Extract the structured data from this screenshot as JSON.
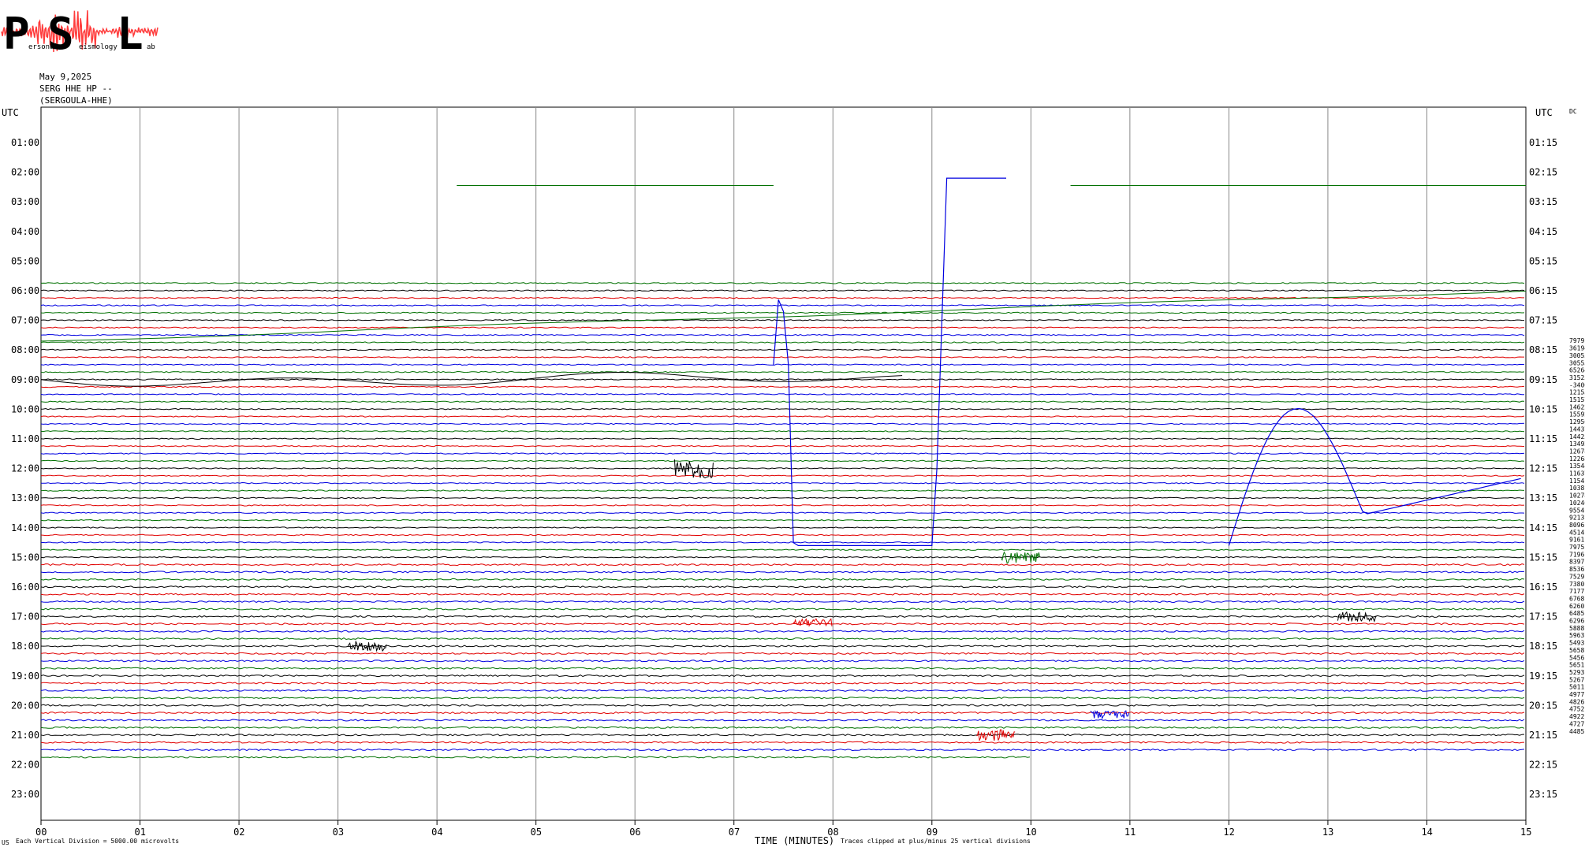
{
  "logo": {
    "letters": [
      "P",
      "S",
      "L"
    ],
    "small_words": [
      "ersonal",
      "eismology",
      "ab"
    ],
    "colors": {
      "letters": "#2ba8d3",
      "waveform": "#ff3b3b"
    }
  },
  "header": {
    "date": "May 9,2025",
    "station": "SERG HHE HP --",
    "location": "(SERGOULA-HHE)"
  },
  "labels": {
    "utc_left": "UTC",
    "utc_right": "UTC",
    "dc": "DC",
    "x_axis_title": "TIME (MINUTES)",
    "vertical_division": "Each Vertical Division = 5000.00 microvolts",
    "clip_note": "Traces clipped at plus/minus 25 vertical divisions",
    "corner": "US"
  },
  "colors": {
    "black": "#000000",
    "red": "#e00000",
    "blue": "#0000e0",
    "green": "#007000",
    "grid": "#888888"
  },
  "chart_data": {
    "type": "line",
    "subtype": "helicorder",
    "x_ticks": [
      "00",
      "01",
      "02",
      "03",
      "04",
      "05",
      "06",
      "07",
      "08",
      "09",
      "10",
      "11",
      "12",
      "13",
      "14",
      "15"
    ],
    "xlim": [
      0,
      15
    ],
    "xlabel": "TIME (MINUTES)",
    "minutes_per_row": 15,
    "row_colors_cycle": [
      "black",
      "red",
      "blue",
      "green"
    ],
    "hour_labels_left": [
      "01:00",
      "02:00",
      "03:00",
      "04:00",
      "05:00",
      "06:00",
      "07:00",
      "08:00",
      "09:00",
      "10:00",
      "11:00",
      "12:00",
      "13:00",
      "14:00",
      "15:00",
      "16:00",
      "17:00",
      "18:00",
      "19:00",
      "20:00",
      "21:00",
      "22:00",
      "23:00"
    ],
    "hour_labels_right": [
      "01:15",
      "02:15",
      "03:15",
      "04:15",
      "05:15",
      "06:15",
      "07:15",
      "08:15",
      "09:15",
      "10:15",
      "11:15",
      "12:15",
      "13:15",
      "14:15",
      "15:15",
      "16:15",
      "17:15",
      "18:15",
      "19:15",
      "20:15",
      "21:15",
      "22:15",
      "23:15"
    ],
    "row_mean_values": [
      "79791",
      "36194",
      "30055",
      "30555",
      "6526462",
      "31525",
      "-34007",
      "12155",
      "15157",
      "14622",
      "15592",
      "12956",
      "14437",
      "14425",
      "13492",
      "12678",
      "12268",
      "13544",
      "11637",
      "11541",
      "10381",
      "10278",
      "10246",
      "9554",
      "9213",
      "8096",
      "4514",
      "9161",
      "7975",
      "7196",
      "8397",
      "8536",
      "7529",
      "7380",
      "7177",
      "6768",
      "6260",
      "6485",
      "6296",
      "5888",
      "5963",
      "5493",
      "5658",
      "5456",
      "5651",
      "5293",
      "5267",
      "5011",
      "4977",
      "4826",
      "4752",
      "4922",
      "4727",
      "4485"
    ],
    "annotations": [
      {
        "label": "clipped blue trace excursion",
        "minute_start": 7.4,
        "minute_end": 9.75
      },
      {
        "label": "long-period swing",
        "minute_start": 12.0,
        "minute_end": 15.0
      }
    ]
  }
}
